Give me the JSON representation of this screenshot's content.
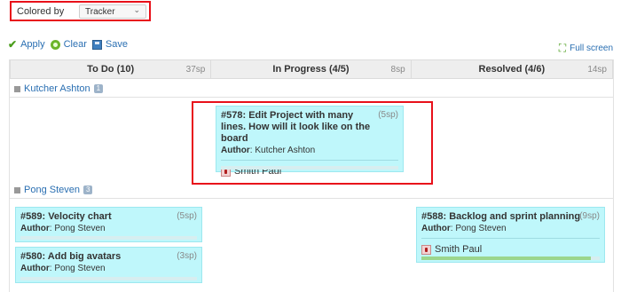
{
  "filter": {
    "colored_by_label": "Colored by",
    "tracker_value": "Tracker"
  },
  "actions": {
    "apply": "Apply",
    "clear": "Clear",
    "save": "Save",
    "full_screen": "Full screen"
  },
  "columns": [
    {
      "title": "To Do (10)",
      "sp": "37sp"
    },
    {
      "title": "In Progress (4/5)",
      "sp": "8sp"
    },
    {
      "title": "Resolved (4/6)",
      "sp": "14sp"
    }
  ],
  "swimlanes": [
    {
      "name": "Kutcher Ashton",
      "count": "1"
    },
    {
      "name": "Pong Steven",
      "count": "3"
    }
  ],
  "cards": {
    "c578": {
      "title": "#578: Edit Project with many lines. How will it look like on the board",
      "sp": "(5sp)",
      "author_label": "Author",
      "author": "Kutcher Ashton",
      "assignee": "Smith Paul"
    },
    "c589": {
      "title": "#589: Velocity chart",
      "sp": "(5sp)",
      "author_label": "Author",
      "author": "Pong Steven"
    },
    "c580": {
      "title": "#580: Add big avatars",
      "sp": "(3sp)",
      "author_label": "Author",
      "author": "Pong Steven"
    },
    "c588": {
      "title": "#588: Backlog and sprint planning",
      "sp": "(9sp)",
      "author_label": "Author",
      "author": "Pong Steven",
      "assignee": "Smith Paul",
      "progress": 0.95
    }
  },
  "colors": {
    "card_bg": "#bff7fb",
    "highlight": "#e8101a",
    "link": "#2a6fb2"
  }
}
